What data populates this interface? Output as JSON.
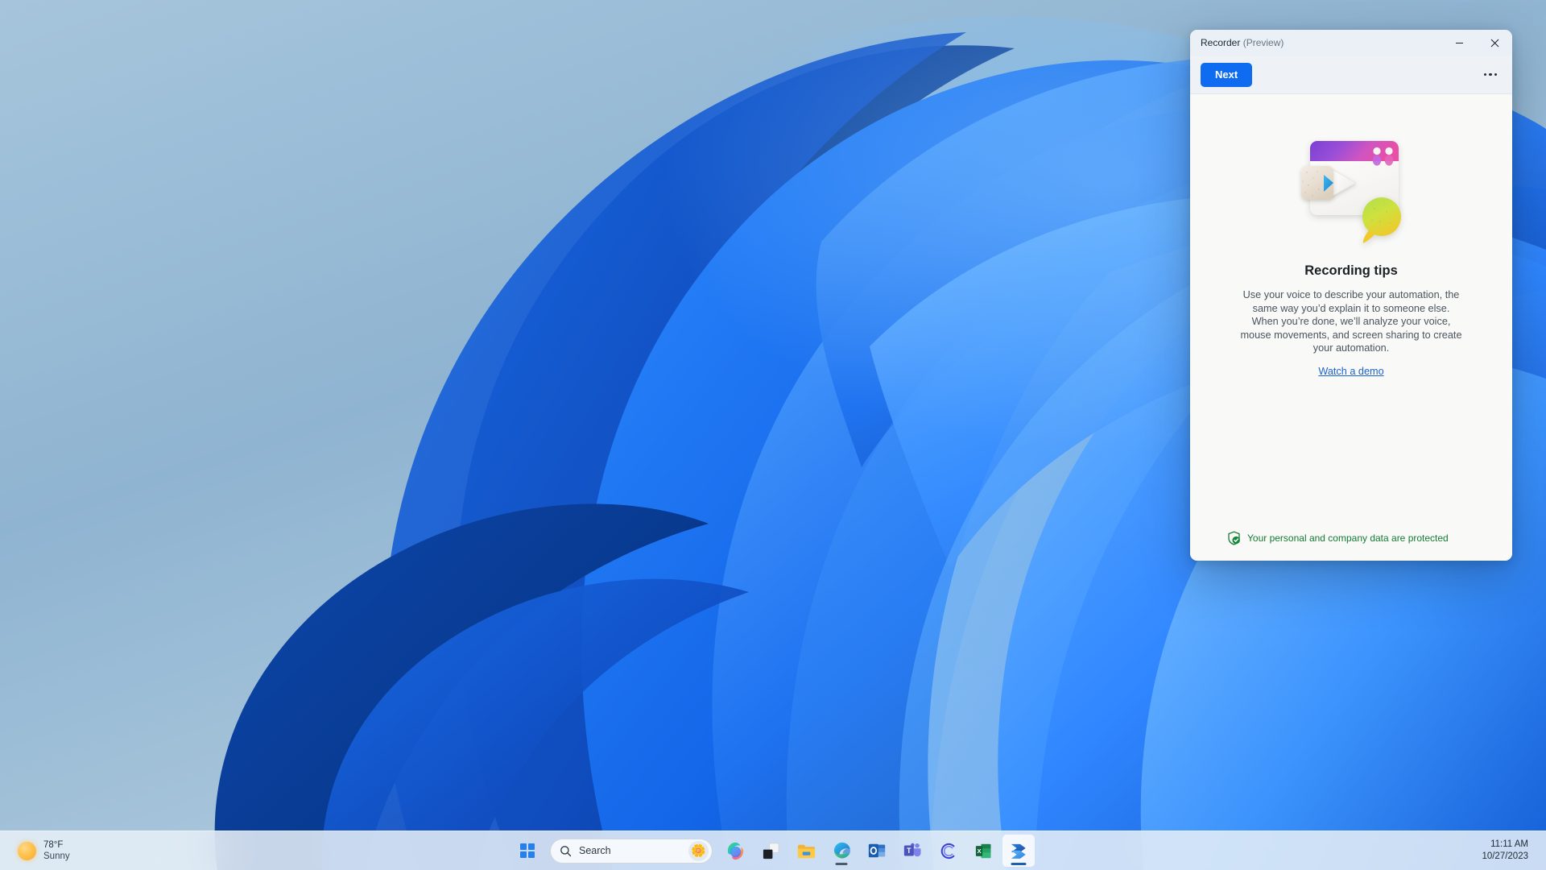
{
  "desktop": {
    "wallpaper_name": "windows-11-bloom-wallpaper",
    "background_color": "#8eb4d0"
  },
  "window": {
    "title_main": "Recorder",
    "title_sub": "(Preview)",
    "minimize_tooltip": "Minimize",
    "close_tooltip": "Close",
    "toolbar": {
      "next_label": "Next",
      "more_tooltip": "See more"
    },
    "content": {
      "illustration_name": "recording-tips-illustration",
      "heading": "Recording tips",
      "body": "Use your voice to describe your automation, the same way you’d explain it to someone else. When you’re done, we’ll analyze your voice, mouse movements, and screen sharing to create your automation.",
      "link_label": "Watch a demo"
    },
    "footer": {
      "privacy_text": "Your personal and company data are protected",
      "privacy_color": "#157a34"
    },
    "accent_color": "#0f6cf0"
  },
  "taskbar": {
    "weather": {
      "temperature": "78°F",
      "condition": "Sunny"
    },
    "search": {
      "placeholder": "Search",
      "badge_icon": "lotus-flower-icon"
    },
    "items": [
      {
        "name": "start-button",
        "label": "Start"
      },
      {
        "name": "copilot-button",
        "label": "Copilot"
      },
      {
        "name": "widgets-button",
        "label": "Widgets"
      },
      {
        "name": "file-explorer-button",
        "label": "File Explorer"
      },
      {
        "name": "edge-button",
        "label": "Microsoft Edge"
      },
      {
        "name": "outlook-button",
        "label": "Outlook"
      },
      {
        "name": "teams-button",
        "label": "Microsoft Teams"
      },
      {
        "name": "copilot-c-button",
        "label": "Copilot"
      },
      {
        "name": "excel-button",
        "label": "Excel"
      },
      {
        "name": "power-automate-button",
        "label": "Power Automate"
      }
    ],
    "clock": {
      "time": "11:11 AM",
      "date": "10/27/2023"
    }
  }
}
